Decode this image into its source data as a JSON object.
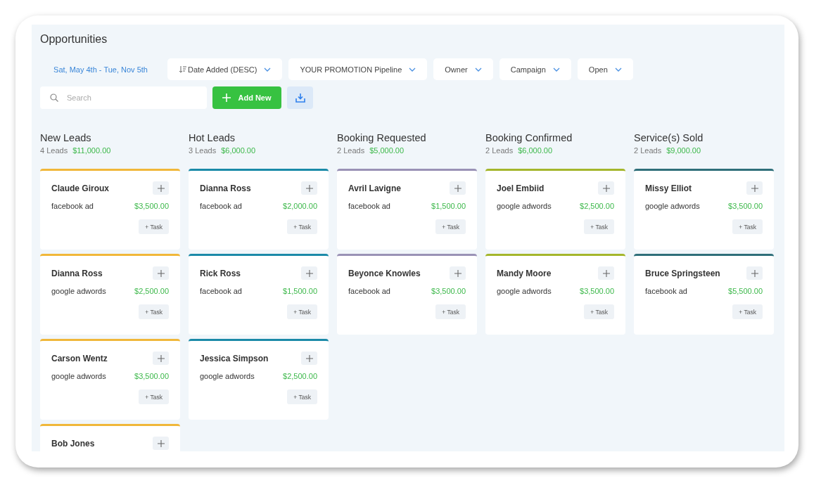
{
  "title": "Opportunities",
  "filters": {
    "date_range": "Sat, May 4th - Tue, Nov 5th",
    "dropdowns": [
      {
        "label": "Date Added (DESC)",
        "kind": "sort"
      },
      {
        "label": "YOUR PROMOTION Pipeline",
        "kind": "plain"
      },
      {
        "label": "Owner",
        "kind": "plain"
      },
      {
        "label": "Campaign",
        "kind": "plain"
      },
      {
        "label": "Open",
        "kind": "plain"
      }
    ]
  },
  "search": {
    "placeholder": "Search"
  },
  "add_button": "Add New",
  "columns": [
    {
      "name": "New Leads",
      "count": "4 Leads",
      "total": "$11,000.00",
      "color": "#f0b73a",
      "cards": [
        {
          "name": "Claude Giroux",
          "source": "facebook ad",
          "amount": "$3,500.00",
          "task": "+ Task"
        },
        {
          "name": "Dianna Ross",
          "source": "google adwords",
          "amount": "$2,500.00",
          "task": "+ Task"
        },
        {
          "name": "Carson Wentz",
          "source": "google adwords",
          "amount": "$3,500.00",
          "task": "+ Task"
        },
        {
          "name": "Bob Jones"
        }
      ]
    },
    {
      "name": "Hot Leads",
      "count": "3 Leads",
      "total": "$6,000.00",
      "color": "#1b8aa8",
      "cards": [
        {
          "name": "Dianna Ross",
          "source": "facebook ad",
          "amount": "$2,000.00",
          "task": "+ Task"
        },
        {
          "name": "Rick Ross",
          "source": "facebook ad",
          "amount": "$1,500.00",
          "task": "+ Task"
        },
        {
          "name": "Jessica Simpson",
          "source": "google adwords",
          "amount": "$2,500.00",
          "task": "+ Task"
        }
      ]
    },
    {
      "name": "Booking Requested",
      "count": "2 Leads",
      "total": "$5,000.00",
      "color": "#9a92b6",
      "cards": [
        {
          "name": "Avril Lavigne",
          "source": "facebook ad",
          "amount": "$1,500.00",
          "task": "+ Task"
        },
        {
          "name": "Beyonce Knowles",
          "source": "facebook ad",
          "amount": "$3,500.00",
          "task": "+ Task"
        }
      ]
    },
    {
      "name": "Booking Confirmed",
      "count": "2 Leads",
      "total": "$6,000.00",
      "color": "#a4b62c",
      "cards": [
        {
          "name": "Joel Embiid",
          "source": "google adwords",
          "amount": "$2,500.00",
          "task": "+ Task"
        },
        {
          "name": "Mandy Moore",
          "source": "google adwords",
          "amount": "$3,500.00",
          "task": "+ Task"
        }
      ]
    },
    {
      "name": "Service(s) Sold",
      "count": "2 Leads",
      "total": "$9,000.00",
      "color": "#2f6f7a",
      "cards": [
        {
          "name": "Missy Elliot",
          "source": "google adwords",
          "amount": "$3,500.00",
          "task": "+ Task"
        },
        {
          "name": "Bruce Springsteen",
          "source": "facebook ad",
          "amount": "$5,500.00",
          "task": "+ Task"
        }
      ]
    }
  ]
}
